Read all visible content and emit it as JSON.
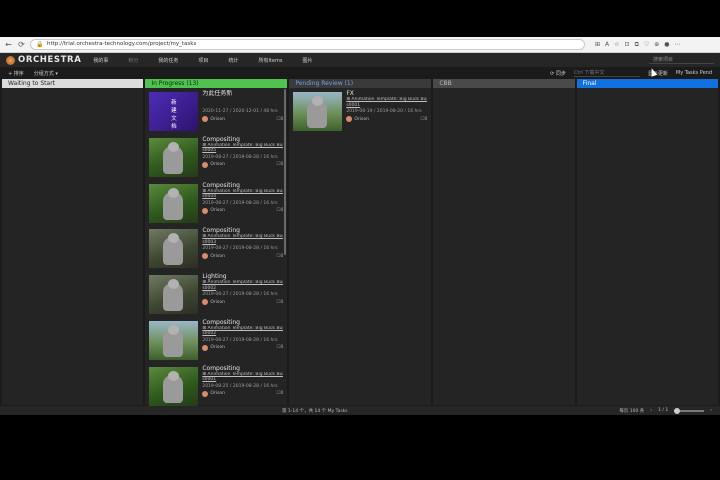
{
  "browser": {
    "url": "http://trial.orchestra-technology.com/project/my_tasks",
    "back": "←",
    "refresh": "⟳",
    "lock": "🔒",
    "icons": [
      "⊞",
      "A",
      "☆",
      "⊡",
      "⧉",
      "♡",
      "⊕",
      "●",
      "⋯"
    ]
  },
  "app": {
    "brand": "ORCHESTRA",
    "nav": [
      "我的事",
      "积分",
      "我的任务",
      "项目",
      "统计",
      "所有Items",
      "图片"
    ],
    "search_placeholder": "搜索项目"
  },
  "toolbar": {
    "left": [
      "+ 排序",
      "分组方式 ▾"
    ],
    "sync": "⟳ 同步",
    "search_placeholder": "Ctrl 下载中文",
    "status_mode": "显示更新",
    "my_tasks": "My Tasks Pend"
  },
  "columns": [
    {
      "title": "Waiting to Start",
      "style": "wait",
      "cards": []
    },
    {
      "title": "In Progress (13)",
      "style": "prog",
      "cards": [
        {
          "thumb": "purple",
          "thumb_text": "新\n建\n文\n档",
          "task": "为此任务新",
          "project": "",
          "shot": "",
          "dates": "2020-11-27 / 2020-12-01 / 48 hrs",
          "assignee": "Orison",
          "comments": "0"
        },
        {
          "thumb": "forest",
          "task": "Compositing",
          "project": "Animation Template: Big Buck Bunny",
          "shot": "s0005",
          "dates": "2019-08-27 / 2019-08-28 / 16 hrs",
          "assignee": "Orison",
          "comments": "0"
        },
        {
          "thumb": "forest",
          "task": "Compositing",
          "project": "Animation Template: Big Buck Bunny",
          "shot": "s0004",
          "dates": "2019-08-27 / 2019-08-28 / 16 hrs",
          "assignee": "Orison",
          "comments": "0"
        },
        {
          "thumb": "dark",
          "task": "Compositing",
          "project": "Animation Template: Big Buck Bunny",
          "shot": "s0003",
          "dates": "2019-08-27 / 2019-08-28 / 16 hrs",
          "assignee": "Orison",
          "comments": "0"
        },
        {
          "thumb": "dark",
          "task": "Lighting",
          "project": "Animation Template: Big Buck Bunny",
          "shot": "s0002",
          "dates": "2019-08-27 / 2019-08-28 / 16 hrs",
          "assignee": "Orison",
          "comments": "0"
        },
        {
          "thumb": "lake",
          "task": "Compositing",
          "project": "Animation Template: Big Buck Bunny",
          "shot": "s0002",
          "dates": "2019-08-27 / 2019-08-28 / 16 hrs",
          "assignee": "Orison",
          "comments": "0"
        },
        {
          "thumb": "forest",
          "task": "Compositing",
          "project": "Animation Template: Big Buck Bunny",
          "shot": "s0001",
          "dates": "2019-08-25 / 2019-08-28 / 16 hrs",
          "assignee": "Orison",
          "comments": "0"
        }
      ]
    },
    {
      "title": "Pending Review (1)",
      "style": "pend",
      "cards": [
        {
          "thumb": "lake",
          "task": "FX",
          "project": "Animation Template: Big Buck Bunny",
          "shot": "s0001",
          "dates": "2019-08-19 / 2019-08-20 / 16 hrs",
          "assignee": "Orison",
          "comments": "0"
        }
      ]
    },
    {
      "title": "CBB",
      "style": "cbb",
      "cards": []
    },
    {
      "title": "Final",
      "style": "final",
      "cards": []
    }
  ],
  "footer": {
    "range": "第 1-14 个，共 14 个 My Tasks",
    "per_page": "每页 100 条",
    "page": "1 / 1"
  }
}
